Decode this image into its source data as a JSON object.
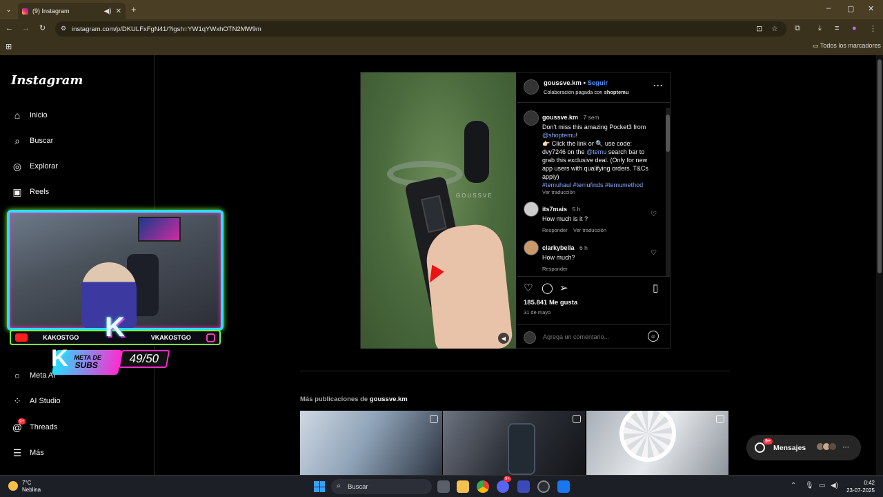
{
  "browser": {
    "tab_title": "(9) Instagram",
    "url": "instagram.com/p/DKULFxFgN41/?igsh=YW1qYWxhOTN2MW9m",
    "bookmarks_label": "Todos los marcadores"
  },
  "sidebar": {
    "logo": "Instagram",
    "items": [
      {
        "label": "Inicio",
        "icon": "home-icon"
      },
      {
        "label": "Buscar",
        "icon": "search-icon"
      },
      {
        "label": "Explorar",
        "icon": "compass-icon"
      },
      {
        "label": "Reels",
        "icon": "reels-icon"
      },
      {
        "label": "Meta AI",
        "icon": "meta-ai-icon"
      },
      {
        "label": "AI Studio",
        "icon": "ai-studio-icon"
      },
      {
        "label": "Threads",
        "icon": "threads-icon",
        "badge": "9+"
      },
      {
        "label": "Más",
        "icon": "menu-icon"
      }
    ]
  },
  "overlay": {
    "left_name": "KAKOSTGO",
    "right_name": "VKAKOSTGO",
    "meta_label_1": "META DE",
    "meta_label_2": "SUBS",
    "count": "49/50"
  },
  "post": {
    "watermark": "GOUSSVE",
    "header": {
      "username": "goussve.km",
      "separator": "•",
      "follow": "Seguir",
      "sub_prefix": "Colaboración pagada con ",
      "sub_brand": "shoptemu"
    },
    "caption": {
      "username": "goussve.km",
      "time": "7 sem",
      "line1": "Don't miss this amazing Pocket3 from",
      "mention": "@shoptemu",
      "mention_after": "!",
      "line2_a": "👉🏻 Click the link or 🔍 use code:",
      "line2_b": "dvy7246 on the ",
      "mention2": "@temu",
      "line2_c": " search bar to grab this exclusive deal. (Only for new app users with qualifying orders. T&Cs apply)",
      "hashtags": "#temuhaul #temufinds #temumethod",
      "translate": "Ver traducción"
    },
    "comments": [
      {
        "username": "its7mais",
        "time": "5 h",
        "text": "How much is it ?",
        "reply": "Responder",
        "translate": "Ver traducción"
      },
      {
        "username": "clarkybella",
        "time": "6 h",
        "text": "How much?",
        "reply": "Responder"
      }
    ],
    "likes": "185.841 Me gusta",
    "date": "31 de mayo",
    "comment_placeholder": "Agrega un comentario..."
  },
  "more": {
    "prefix": "Más publicaciones de ",
    "username": "goussve.km"
  },
  "messages": {
    "label": "Mensajes",
    "badge": "9+"
  },
  "taskbar": {
    "weather_temp": "7°C",
    "weather_desc": "Neblina",
    "search": "Buscar",
    "time": "0:42",
    "date": "23-07-2025",
    "discord_badge": "9+"
  },
  "colors": {
    "accent_link": "#4c8dff",
    "badge_red": "#ff3040",
    "chrome_brown": "#3a321c"
  }
}
